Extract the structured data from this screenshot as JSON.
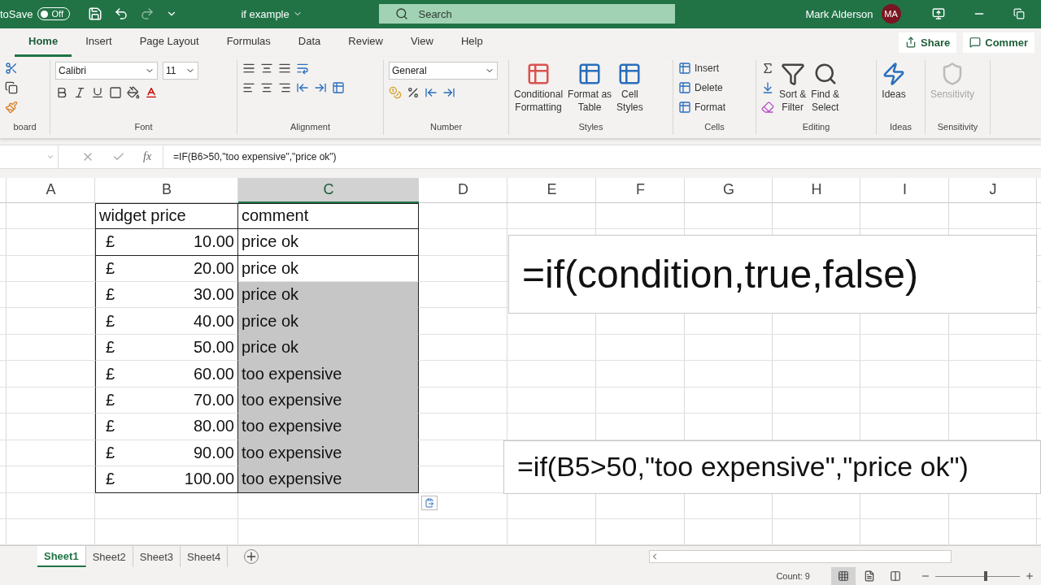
{
  "title_bar": {
    "autosave_label": "toSave",
    "autosave_on": false,
    "autosave_state": "Off",
    "file_name": "if example",
    "search_placeholder": "Search",
    "user_name": "Mark Alderson",
    "user_initials": "MA"
  },
  "ribbon_tabs": [
    {
      "label": "Home",
      "selected": true
    },
    {
      "label": "Insert",
      "selected": false
    },
    {
      "label": "Page Layout",
      "selected": false
    },
    {
      "label": "Formulas",
      "selected": false
    },
    {
      "label": "Data",
      "selected": false
    },
    {
      "label": "Review",
      "selected": false
    },
    {
      "label": "View",
      "selected": false
    },
    {
      "label": "Help",
      "selected": false
    }
  ],
  "ribbon_actions": [
    {
      "kind": "share",
      "label": "Share"
    },
    {
      "kind": "comments",
      "label": "Commer"
    }
  ],
  "ribbon_groups": [
    {
      "kind": "clipboard",
      "label": "board"
    },
    {
      "kind": "font",
      "label": "Font",
      "font_name": "Calibri",
      "font_size": "11"
    },
    {
      "kind": "alignment",
      "label": "Alignment"
    },
    {
      "kind": "number",
      "label": "Number",
      "format": "General"
    },
    {
      "kind": "styles",
      "label": "Styles",
      "buttons": [
        "Conditional\nFormatting",
        "Format as\nTable",
        "Cell\nStyles"
      ]
    },
    {
      "kind": "cells",
      "label": "Cells",
      "buttons": [
        "Insert",
        "Delete",
        "Format"
      ]
    },
    {
      "kind": "editing",
      "label": "Editing",
      "buttons": [
        "Sort &\nFilter",
        "Find &\nSelect"
      ]
    },
    {
      "kind": "ideas",
      "label": "Ideas",
      "button": "Ideas"
    },
    {
      "kind": "sensitivity",
      "label": "Sensitivity",
      "button": "Sensitivity"
    }
  ],
  "formula_bar": {
    "function_label": "fx",
    "formula": "=IF(B6>50,\"too expensive\",\"price ok\")"
  },
  "columns": [
    {
      "label": "A",
      "selected": false
    },
    {
      "label": "B",
      "selected": false
    },
    {
      "label": "C",
      "selected": true
    },
    {
      "label": "D",
      "selected": false
    },
    {
      "label": "E",
      "selected": false
    },
    {
      "label": "F",
      "selected": false
    },
    {
      "label": "G",
      "selected": false
    },
    {
      "label": "H",
      "selected": false
    },
    {
      "label": "I",
      "selected": false
    },
    {
      "label": "J",
      "selected": false
    }
  ],
  "table_header": {
    "price": "widget price",
    "comment": "comment"
  },
  "rows": [
    {
      "currency": "£",
      "price": "10.00",
      "comment": "price ok",
      "selected": false
    },
    {
      "currency": "£",
      "price": "20.00",
      "comment": "price ok",
      "selected": false
    },
    {
      "currency": "£",
      "price": "30.00",
      "comment": "price ok",
      "selected": true
    },
    {
      "currency": "£",
      "price": "40.00",
      "comment": "price ok",
      "selected": true
    },
    {
      "currency": "£",
      "price": "50.00",
      "comment": "price ok",
      "selected": true
    },
    {
      "currency": "£",
      "price": "60.00",
      "comment": "too expensive",
      "selected": true
    },
    {
      "currency": "£",
      "price": "70.00",
      "comment": "too expensive",
      "selected": true
    },
    {
      "currency": "£",
      "price": "80.00",
      "comment": "too expensive",
      "selected": true
    },
    {
      "currency": "£",
      "price": "90.00",
      "comment": "too expensive",
      "selected": true
    },
    {
      "currency": "£",
      "price": "100.00",
      "comment": "too expensive",
      "selected": true
    }
  ],
  "text_boxes": [
    {
      "text": "=if(condition,true,false)"
    },
    {
      "text": "=if(B5>50,\"too expensive\",\"price ok\")"
    }
  ],
  "sheets": [
    {
      "label": "Sheet1",
      "selected": true
    },
    {
      "label": "Sheet2",
      "selected": false
    },
    {
      "label": "Sheet3",
      "selected": false
    },
    {
      "label": "Sheet4",
      "selected": false
    }
  ],
  "status_bar": {
    "count": "Count: 9",
    "views": [
      {
        "kind": "normal",
        "selected": true
      },
      {
        "kind": "page_layout",
        "selected": false
      },
      {
        "kind": "page_break",
        "selected": false
      }
    ],
    "zoom": {
      "level": 0.6
    }
  }
}
